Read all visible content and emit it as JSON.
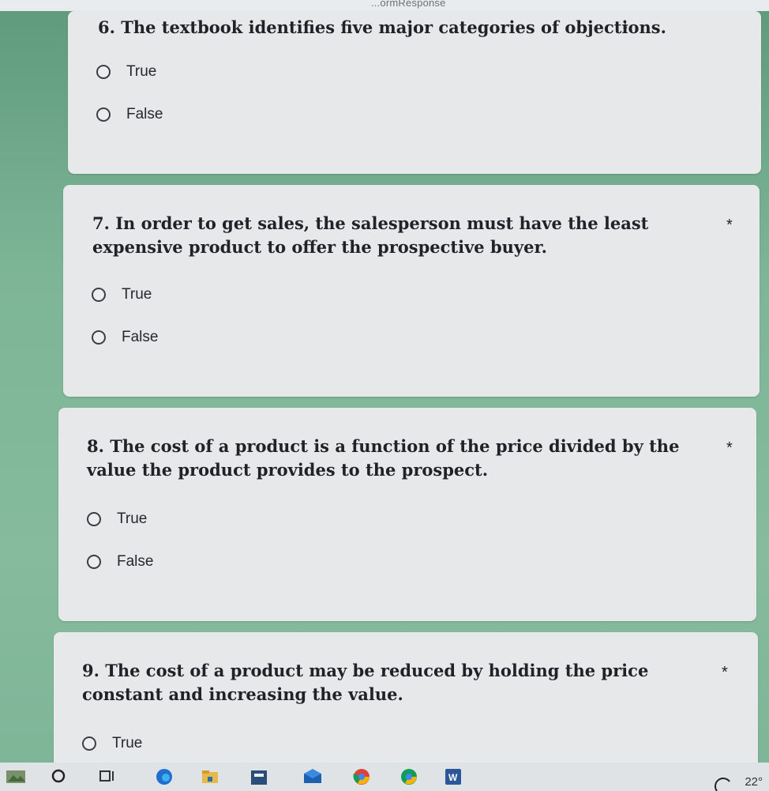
{
  "browser": {
    "url_fragment": "...ormResponse"
  },
  "questions": [
    {
      "number_title": "6. The textbook identifies five major categories of objections.",
      "required": "*",
      "options": [
        "True",
        "False"
      ]
    },
    {
      "number_title": "7. In order to get sales, the salesperson must have the least expensive product to offer the prospective buyer.",
      "required": "*",
      "options": [
        "True",
        "False"
      ]
    },
    {
      "number_title": "8. The cost of a product is a function of the price divided by the value the product provides to the prospect.",
      "required": "*",
      "options": [
        "True",
        "False"
      ]
    },
    {
      "number_title": "9. The cost of a product may be reduced by holding the price constant and increasing the value.",
      "required": "*",
      "options": [
        "True"
      ]
    }
  ],
  "taskbar": {
    "icons": [
      "weather-icon",
      "search-circle-icon",
      "task-view-icon",
      "edge-icon",
      "file-explorer-icon",
      "calculator-icon",
      "mail-icon",
      "chrome-icon",
      "chrome-profile-icon",
      "word-icon"
    ],
    "temperature": "22°"
  }
}
